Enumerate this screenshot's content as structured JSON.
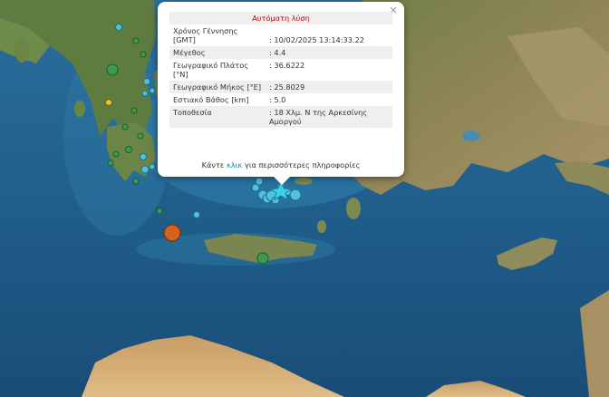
{
  "popup": {
    "title": "Αυτόματη λύση",
    "close_symbol": "×",
    "rows": [
      {
        "label": "Χρόνος Γέννησης [GMT]",
        "value": ": 10/02/2025 13:14:33.22"
      },
      {
        "label": "Μέγεθος",
        "value": ": 4.4"
      },
      {
        "label": "Γεωγραφικό Πλάτος [°N]",
        "value": ": 36.6222"
      },
      {
        "label": "Γεωγραφικό Μήκος [°E]",
        "value": ": 25.8029"
      },
      {
        "label": "Εστιακό Βάθος [km]",
        "value": ": 5.0"
      },
      {
        "label": "Τοποθεσία",
        "value": ": 18 Χλμ. Ν της Αρκεσίνης Αμοργού"
      }
    ],
    "more_prefix": "Κάντε ",
    "more_link": "κλικ",
    "more_suffix": " για περισσότερες πληροφορίες"
  },
  "colors": {
    "sea_deep": "#1a4d78",
    "sea_mid": "#2a6f9c",
    "sea_shallow": "#3f93b9",
    "land_green": "#5c7a3e",
    "land_brown": "#9c8a5c",
    "desert": "#d8b27a",
    "quake_green": "#3c9a52",
    "quake_cyan": "#4ec3e0",
    "quake_orange": "#d5621c",
    "quake_yellow": "#e0c23c",
    "star": "#3fd0ee"
  },
  "map": {
    "main_event_icon": "star-icon"
  }
}
